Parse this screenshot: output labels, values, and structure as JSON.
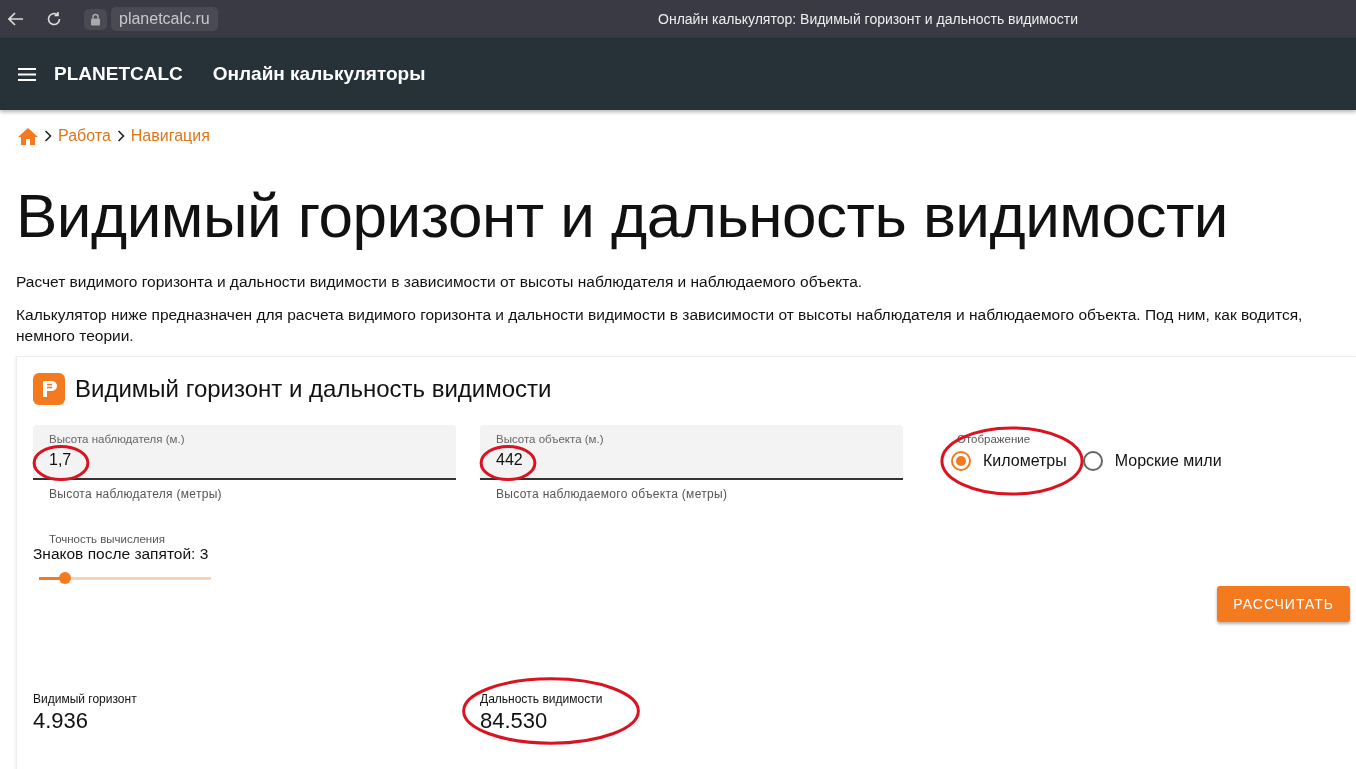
{
  "browser": {
    "url": "planetcalc.ru",
    "title": "Онлайн калькулятор: Видимый горизонт и дальность видимости"
  },
  "header": {
    "brand": "PLANETCALC",
    "section": "Онлайн калькуляторы"
  },
  "breadcrumbs": [
    "Работа",
    "Навигация"
  ],
  "page_title": "Видимый горизонт и дальность видимости",
  "paragraphs": [
    "Расчет видимого горизонта и дальности видимости в зависимости от высоты наблюдателя и наблюдаемого объекта.",
    "Калькулятор ниже предназначен для расчета видимого горизонта и дальности видимости в зависимости от высоты наблюдателя и наблюдаемого объекта. Под ним, как водится, немного теории."
  ],
  "calculator": {
    "title": "Видимый горизонт и дальность видимости",
    "fields": [
      {
        "label": "Высота наблюдателя (м.)",
        "value": "1,7",
        "hint": "Высота наблюдателя (метры)",
        "circled": true
      },
      {
        "label": "Высота объекта (м.)",
        "value": "442",
        "hint": "Высота наблюдаемого объекта (метры)",
        "circled": true
      }
    ],
    "display": {
      "label": "Отображение",
      "options": [
        {
          "label": "Километры",
          "selected": true,
          "circled": true
        },
        {
          "label": "Морские мили",
          "selected": false,
          "circled": false
        }
      ]
    },
    "precision": {
      "label": "Точность вычисления",
      "reading": "Знаков после запятой: 3",
      "level": 0.15
    },
    "button": "РАССЧИТАТЬ",
    "results": [
      {
        "label": "Видимый горизонт",
        "value": "4.936",
        "circled": false
      },
      {
        "label": "Дальность видимости",
        "value": "84.530",
        "circled": true
      }
    ]
  }
}
